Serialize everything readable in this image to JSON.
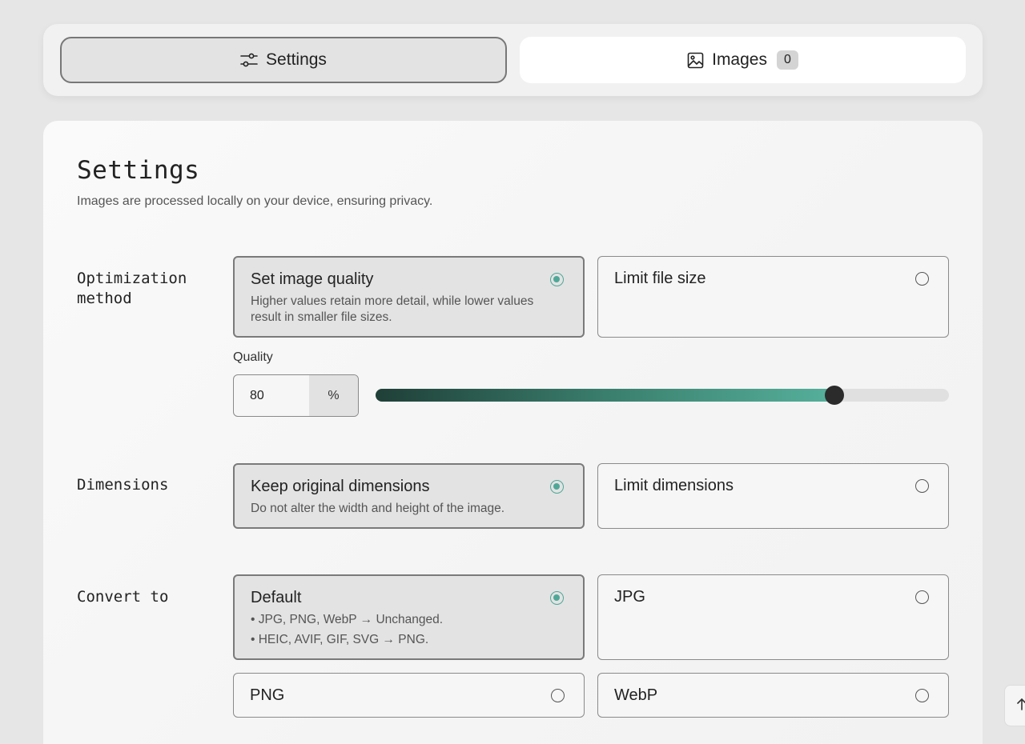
{
  "tabs": {
    "settings": {
      "label": "Settings",
      "icon": "sliders-icon"
    },
    "images": {
      "label": "Images",
      "icon": "image-icon",
      "count": "0"
    }
  },
  "page": {
    "title": "Settings",
    "subtitle": "Images are processed locally on your device, ensuring privacy."
  },
  "optimization": {
    "label_line1": "Optimization",
    "label_line2": "method",
    "options": [
      {
        "title": "Set image quality",
        "desc": "Higher values retain more detail, while lower values result in smaller file sizes.",
        "selected": true
      },
      {
        "title": "Limit file size",
        "desc": "",
        "selected": false
      }
    ],
    "quality": {
      "label": "Quality",
      "value": "80",
      "unit": "%",
      "slider_percent": 80
    }
  },
  "dimensions": {
    "label": "Dimensions",
    "options": [
      {
        "title": "Keep original dimensions",
        "desc": "Do not alter the width and height of the image.",
        "selected": true
      },
      {
        "title": "Limit dimensions",
        "desc": "",
        "selected": false
      }
    ]
  },
  "convert": {
    "label": "Convert to",
    "options": [
      {
        "title": "Default",
        "desc_lines": [
          "• JPG, PNG, WebP → Unchanged.",
          "• HEIC, AVIF, GIF, SVG → PNG."
        ],
        "selected": true
      },
      {
        "title": "JPG",
        "selected": false
      },
      {
        "title": "PNG",
        "selected": false
      },
      {
        "title": "WebP",
        "selected": false
      }
    ]
  },
  "colors": {
    "accent": "#4fa897",
    "slider_dark": "#1f3f37",
    "thumb": "#2b2b2b"
  }
}
